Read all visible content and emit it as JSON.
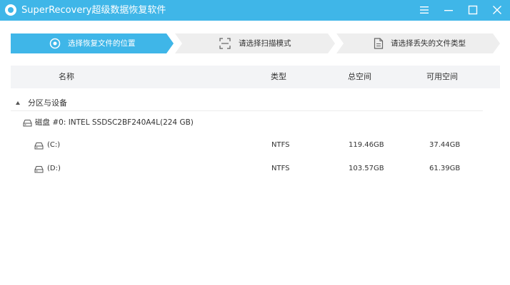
{
  "app": {
    "title": "SuperRecovery超级数据恢复软件"
  },
  "steps": [
    {
      "label": "选择恢复文件的位置",
      "active": true,
      "icon": "target-icon"
    },
    {
      "label": "请选择扫描模式",
      "active": false,
      "icon": "scan-frame-icon"
    },
    {
      "label": "请选择丢失的文件类型",
      "active": false,
      "icon": "document-icon"
    }
  ],
  "table": {
    "headers": {
      "name": "名称",
      "type": "类型",
      "total": "总空间",
      "free": "可用空间"
    },
    "group": {
      "label": "分区与设备",
      "expanded": true
    },
    "disk": {
      "label": "磁盘 #0: INTEL SSDSC2BF240A4L(224 GB)",
      "icon": "hard-disk-icon"
    },
    "partitions": [
      {
        "name": "(C:)",
        "type": "NTFS",
        "total": "119.46GB",
        "free": "37.44GB",
        "icon": "drive-icon"
      },
      {
        "name": "(D:)",
        "type": "NTFS",
        "total": "103.57GB",
        "free": "61.39GB",
        "icon": "drive-icon"
      }
    ]
  },
  "colors": {
    "accent": "#3fb6e8",
    "inactive_step": "#eeeeee",
    "header_bg": "#f3f4f6"
  }
}
